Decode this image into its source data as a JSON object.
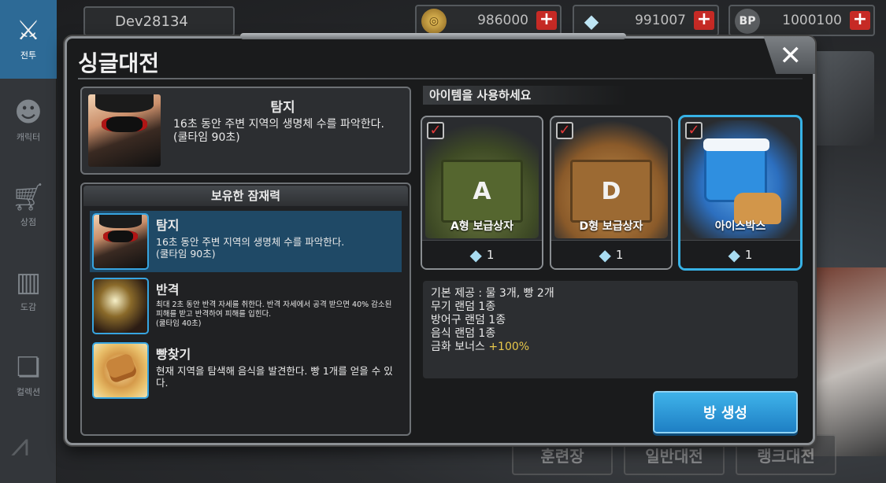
{
  "user": {
    "name": "Dev28134"
  },
  "currencies": [
    {
      "icon": "gold-coin-icon",
      "value": "986000"
    },
    {
      "icon": "crystal-icon",
      "value": "991007"
    },
    {
      "icon": "bp-icon",
      "icon_text": "BP",
      "value": "1000100"
    }
  ],
  "sidebar": {
    "items": [
      {
        "label": "전투",
        "icon": "crossed-weapons-icon"
      },
      {
        "label": "캐릭터",
        "icon": "character-icon"
      },
      {
        "label": "상점",
        "icon": "cart-icon"
      },
      {
        "label": "도감",
        "icon": "books-icon"
      },
      {
        "label": "컬렉션",
        "icon": "open-book-icon"
      }
    ]
  },
  "background": {
    "buttons": [
      "훈련장",
      "일반대전",
      "랭크대전"
    ]
  },
  "modal": {
    "title": "싱글대전",
    "selected_skill": {
      "name": "탐지",
      "desc": "16초 동안 주변 지역의 생명체 수를 파악한다.\n(쿨타임 90초)"
    },
    "potential": {
      "header": "보유한 잠재력",
      "items": [
        {
          "name": "탐지",
          "desc": "16초 동안 주변 지역의 생명체 수를 파악한다.\n(쿨타임 90초)"
        },
        {
          "name": "반격",
          "desc": "최대 2초 동안 반격 자세를 취한다. 반격 자세에서 공격 받으면 40% 감소된 피해를 받고 반격하여 피해를 입힌다.\n(쿨타임 40초)"
        },
        {
          "name": "빵찾기",
          "desc": "현재 지역을 탐색해 음식을 발견한다. 빵 1개를 얻을 수 있다."
        }
      ]
    },
    "items_header": "아이템을 사용하세요",
    "items": [
      {
        "label": "A형 보급상자",
        "crate_letter": "A",
        "cost": "1"
      },
      {
        "label": "D형 보급상자",
        "crate_letter": "D",
        "cost": "1"
      },
      {
        "label": "아이스박스",
        "cost": "1"
      }
    ],
    "info": {
      "lines": [
        "기본 제공 : 물 3개, 빵 2개",
        "무기 랜덤 1종",
        "방어구 랜덤 1종",
        "음식 랜덤 1종"
      ],
      "bonus_label": "금화 보너스",
      "bonus_value": "+100%"
    },
    "create_button": "방 생성",
    "close": "✕"
  },
  "colors": {
    "accent": "#37b2e6",
    "bonus": "#e8c84a",
    "check": "#e23a3a"
  }
}
